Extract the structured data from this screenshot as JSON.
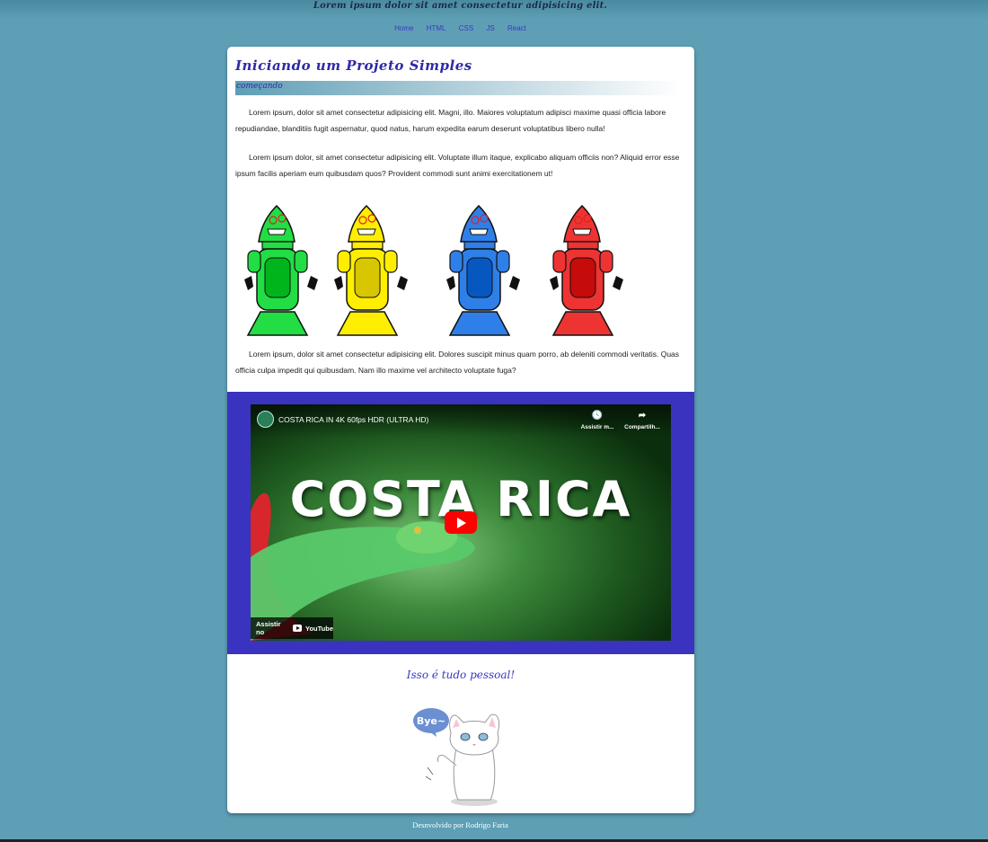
{
  "header": {
    "tagline": "Lorem ipsum dolor sit amet consectetur adipisicing elit."
  },
  "nav": {
    "items": [
      "Home",
      "HTML",
      "CSS",
      "JS",
      "React"
    ]
  },
  "article": {
    "title": "Iniciando um Projeto Simples",
    "subtitle": "começando",
    "paragraphs": [
      "Lorem ipsum, dolor sit amet consectetur adipisicing elit. Magni, illo. Maiores voluptatum adipisci maxime quasi officia labore repudiandae, blanditiis fugit aspernatur, quod natus, harum expedita earum deserunt voluptatibus libero nulla!",
      "Lorem ipsum dolor, sit amet consectetur adipisicing elit. Voluptate illum itaque, explicabo aliquam officiis non? Aliquid error esse ipsum facilis aperiam eum quibusdam quos? Provident commodi sunt animi exercitationem ut!",
      "Lorem ipsum, dolor sit amet consectetur adipisicing elit. Dolores suscipit minus quam porro, ab deleniti commodi veritatis. Quas officia culpa impedit qui quibusdam. Nam illo maxime vel architecto voluptate fuga?"
    ],
    "robot_colors": [
      "#22dd44",
      "#ffee00",
      "#2f7fe8",
      "#ee3333"
    ]
  },
  "video": {
    "title": "COSTA RICA IN 4K 60fps HDR (ULTRA HD)",
    "big_text": "COSTA RICA",
    "watch_later": "Assistir m...",
    "share": "Compartilh...",
    "watch_on": "Assistir no",
    "youtube": "YouTube"
  },
  "closing": {
    "text": "Isso é tudo pessoal!",
    "bubble": "Bye~"
  },
  "footer": {
    "text": "Desnvolvido por Rodrigo Faria"
  }
}
